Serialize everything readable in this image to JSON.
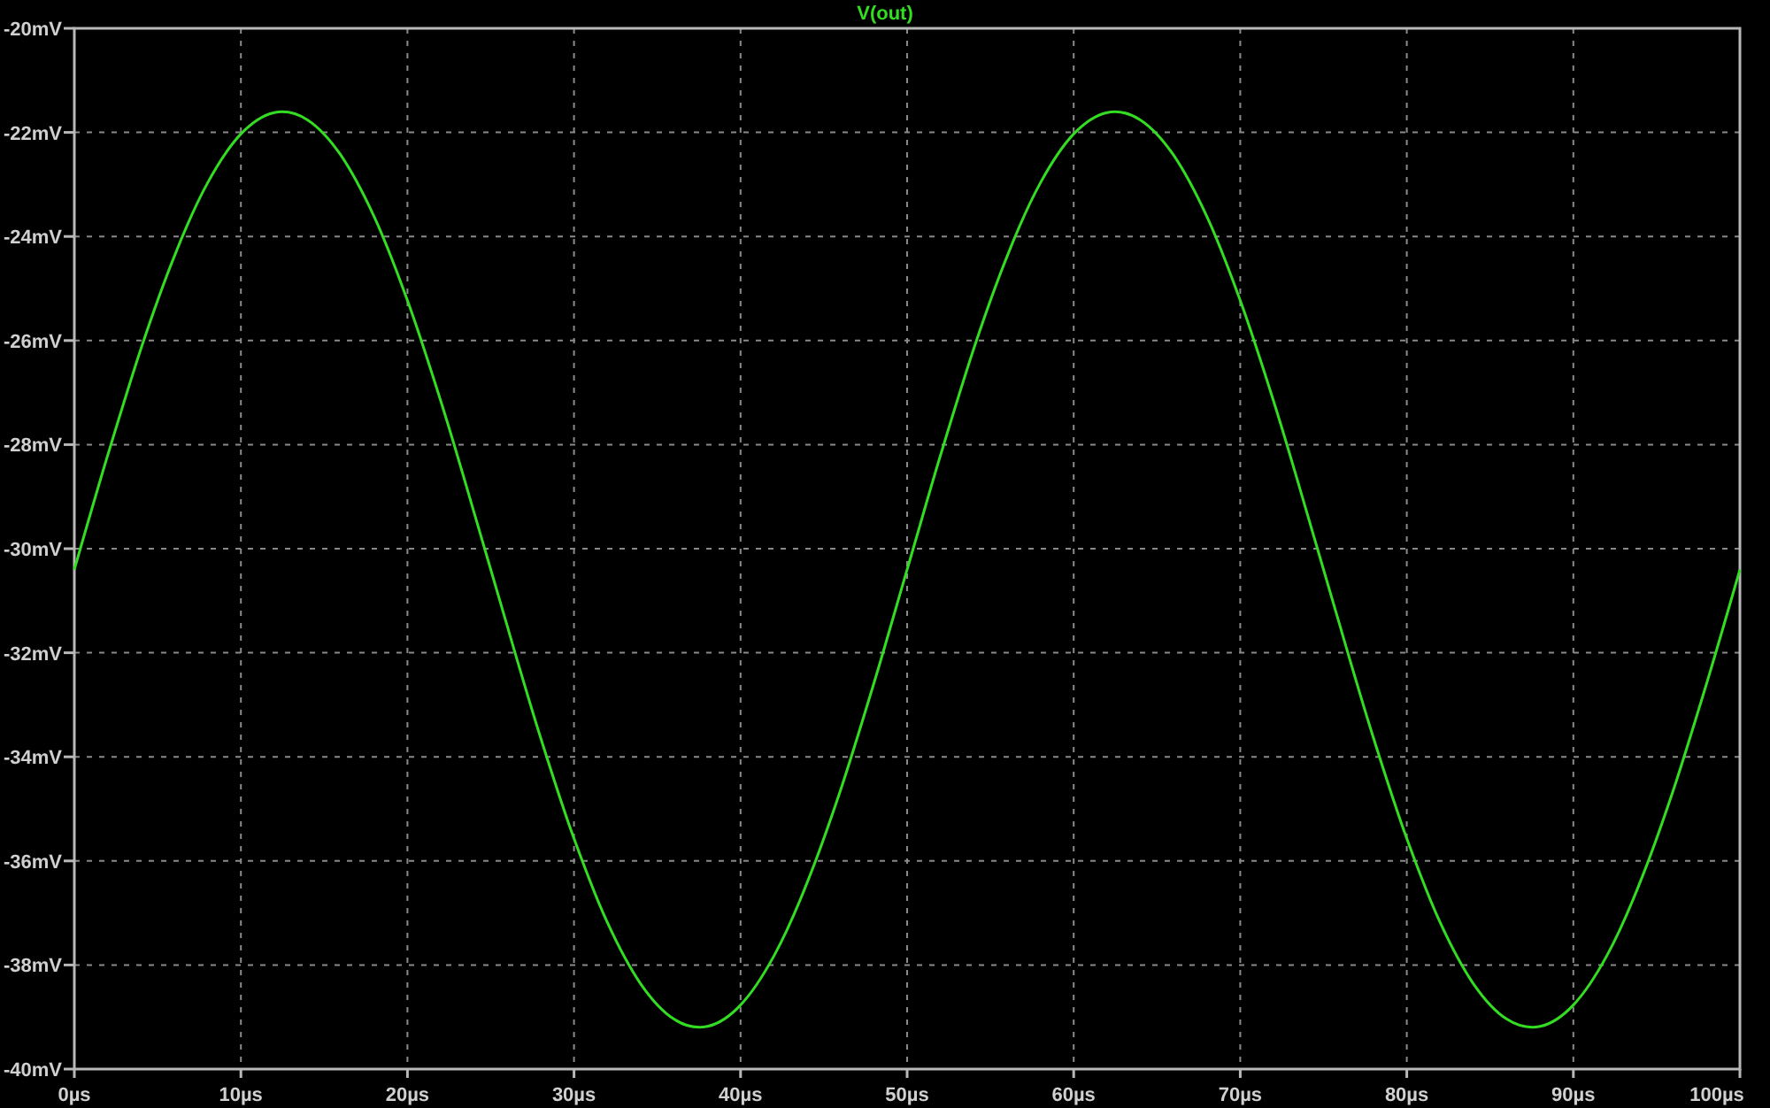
{
  "chart_data": {
    "type": "line",
    "grid": true,
    "x": [
      0,
      2,
      4,
      6,
      8,
      10,
      12,
      14,
      16,
      18,
      20,
      22,
      24,
      26,
      28,
      30,
      32,
      34,
      36,
      38,
      40,
      42,
      44,
      46,
      48,
      50,
      52,
      54,
      56,
      58,
      60,
      62,
      64,
      66,
      68,
      70,
      72,
      74,
      76,
      78,
      80,
      82,
      84,
      86,
      88,
      90,
      92,
      94,
      96,
      98,
      100
    ],
    "series": [
      {
        "name": "V(out)",
        "color": "#33dd22",
        "values": [
          -30.4,
          -28.21,
          -26.16,
          -24.38,
          -22.97,
          -22.03,
          -21.62,
          -21.76,
          -22.44,
          -23.62,
          -25.23,
          -27.16,
          -29.3,
          -31.5,
          -33.64,
          -35.57,
          -37.18,
          -38.36,
          -39.04,
          -39.18,
          -38.77,
          -37.83,
          -36.42,
          -34.64,
          -32.59,
          -30.4,
          -28.21,
          -26.16,
          -24.38,
          -22.97,
          -22.03,
          -21.62,
          -21.76,
          -22.44,
          -23.62,
          -25.23,
          -27.16,
          -29.3,
          -31.5,
          -33.64,
          -35.57,
          -37.18,
          -38.36,
          -39.04,
          -39.18,
          -38.77,
          -37.83,
          -36.42,
          -34.64,
          -32.59,
          -30.4
        ]
      }
    ],
    "xlim": [
      0,
      100
    ],
    "ylim": [
      -40,
      -20
    ],
    "xticks": [
      {
        "value": 0,
        "label": "0µs"
      },
      {
        "value": 10,
        "label": "10µs"
      },
      {
        "value": 20,
        "label": "20µs"
      },
      {
        "value": 30,
        "label": "30µs"
      },
      {
        "value": 40,
        "label": "40µs"
      },
      {
        "value": 50,
        "label": "50µs"
      },
      {
        "value": 60,
        "label": "60µs"
      },
      {
        "value": 70,
        "label": "70µs"
      },
      {
        "value": 80,
        "label": "80µs"
      },
      {
        "value": 90,
        "label": "90µs"
      },
      {
        "value": 100,
        "label": "100µs"
      }
    ],
    "yticks": [
      {
        "value": -20,
        "label": "-20mV"
      },
      {
        "value": -22,
        "label": "-22mV"
      },
      {
        "value": -24,
        "label": "-24mV"
      },
      {
        "value": -26,
        "label": "-26mV"
      },
      {
        "value": -28,
        "label": "-28mV"
      },
      {
        "value": -30,
        "label": "-30mV"
      },
      {
        "value": -32,
        "label": "-32mV"
      },
      {
        "value": -34,
        "label": "-34mV"
      },
      {
        "value": -36,
        "label": "-36mV"
      },
      {
        "value": -38,
        "label": "-38mV"
      },
      {
        "value": -40,
        "label": "-40mV"
      }
    ]
  }
}
